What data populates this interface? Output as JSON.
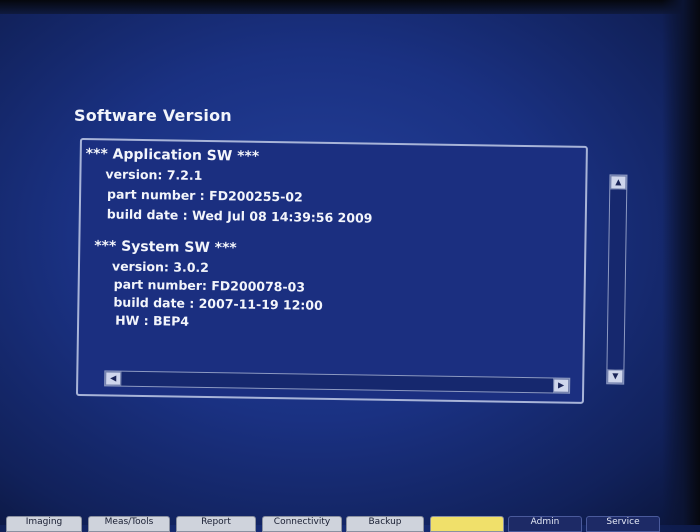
{
  "window": {
    "title": "Software Version"
  },
  "application_sw": {
    "header": "*** Application SW ***",
    "version": "version: 7.2.1",
    "part_number": "part number : FD200255-02",
    "build_date": "build date : Wed Jul 08 14:39:56 2009"
  },
  "system_sw": {
    "header": "*** System SW ***",
    "version": "version: 3.0.2",
    "part_number": "part number: FD200078-03",
    "build_date": "build date : 2007-11-19 12:00",
    "hw": "HW : BEP4"
  },
  "scrollbar": {
    "up_icon": "arrow-up-icon",
    "down_icon": "arrow-down-icon",
    "left_icon": "arrow-left-icon",
    "right_icon": "arrow-right-icon"
  },
  "softkeys": [
    {
      "label": "Imaging"
    },
    {
      "label": "Meas/Tools"
    },
    {
      "label": "Report"
    },
    {
      "label": "Connectivity"
    },
    {
      "label": "Backup"
    },
    {
      "label": ""
    },
    {
      "label": "Admin"
    },
    {
      "label": "Service"
    }
  ],
  "colors": {
    "background": "#1a3182",
    "text": "#f3f5fb",
    "active_key": "#f0e06a"
  }
}
